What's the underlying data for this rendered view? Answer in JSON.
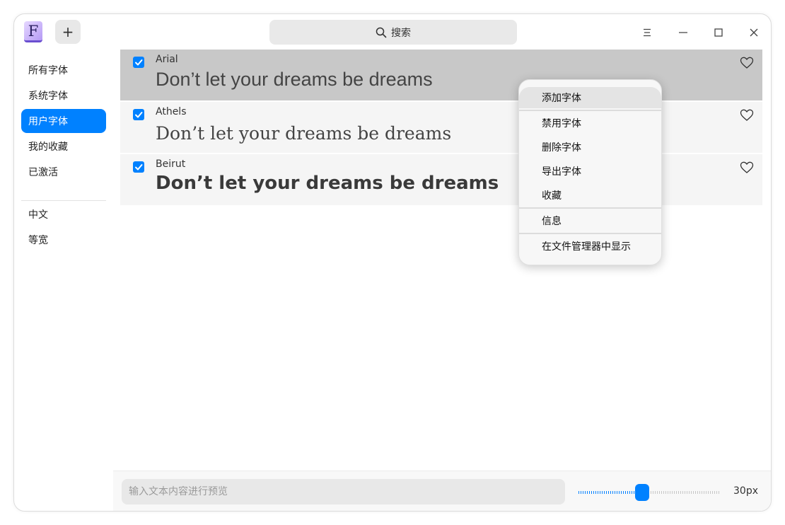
{
  "app": {
    "icon_letter": "F",
    "add_label": "+",
    "search_label": "搜索"
  },
  "sidebar": {
    "items": [
      {
        "label": "所有字体"
      },
      {
        "label": "系统字体"
      },
      {
        "label": "用户字体",
        "active": true
      },
      {
        "label": "我的收藏"
      },
      {
        "label": "已激活"
      }
    ],
    "groups": [
      {
        "label": "中文"
      },
      {
        "label": "等宽"
      }
    ]
  },
  "fonts": [
    {
      "name": "Arial",
      "preview": "Don’t let your dreams be dreams",
      "checked": true,
      "selected": true
    },
    {
      "name": "Athels",
      "preview": "Don’t let your dreams be dreams",
      "checked": true,
      "selected": false
    },
    {
      "name": "Beirut",
      "preview": "Don’t let your dreams be dreams",
      "checked": true,
      "selected": false
    }
  ],
  "context_menu": {
    "items": [
      {
        "label": "添加字体"
      },
      {
        "label": "禁用字体"
      },
      {
        "label": "删除字体"
      },
      {
        "label": "导出字体"
      },
      {
        "label": "收藏"
      },
      {
        "label": "信息"
      },
      {
        "label": "在文件管理器中显示"
      }
    ]
  },
  "bottom": {
    "preview_placeholder": "输入文本内容进行预览",
    "size_value": 30,
    "size_label": "30px",
    "slider_fraction": 0.45
  },
  "colors": {
    "accent": "#0081ff",
    "selected_row": "#c8c8c8",
    "row": "#f5f5f5"
  },
  "icons": {
    "search": "search-icon",
    "menu": "hamburger-icon",
    "minimize": "minimize-icon",
    "maximize": "maximize-icon",
    "close": "close-icon",
    "favorite": "heart-icon",
    "check": "checkbox-check-icon"
  }
}
